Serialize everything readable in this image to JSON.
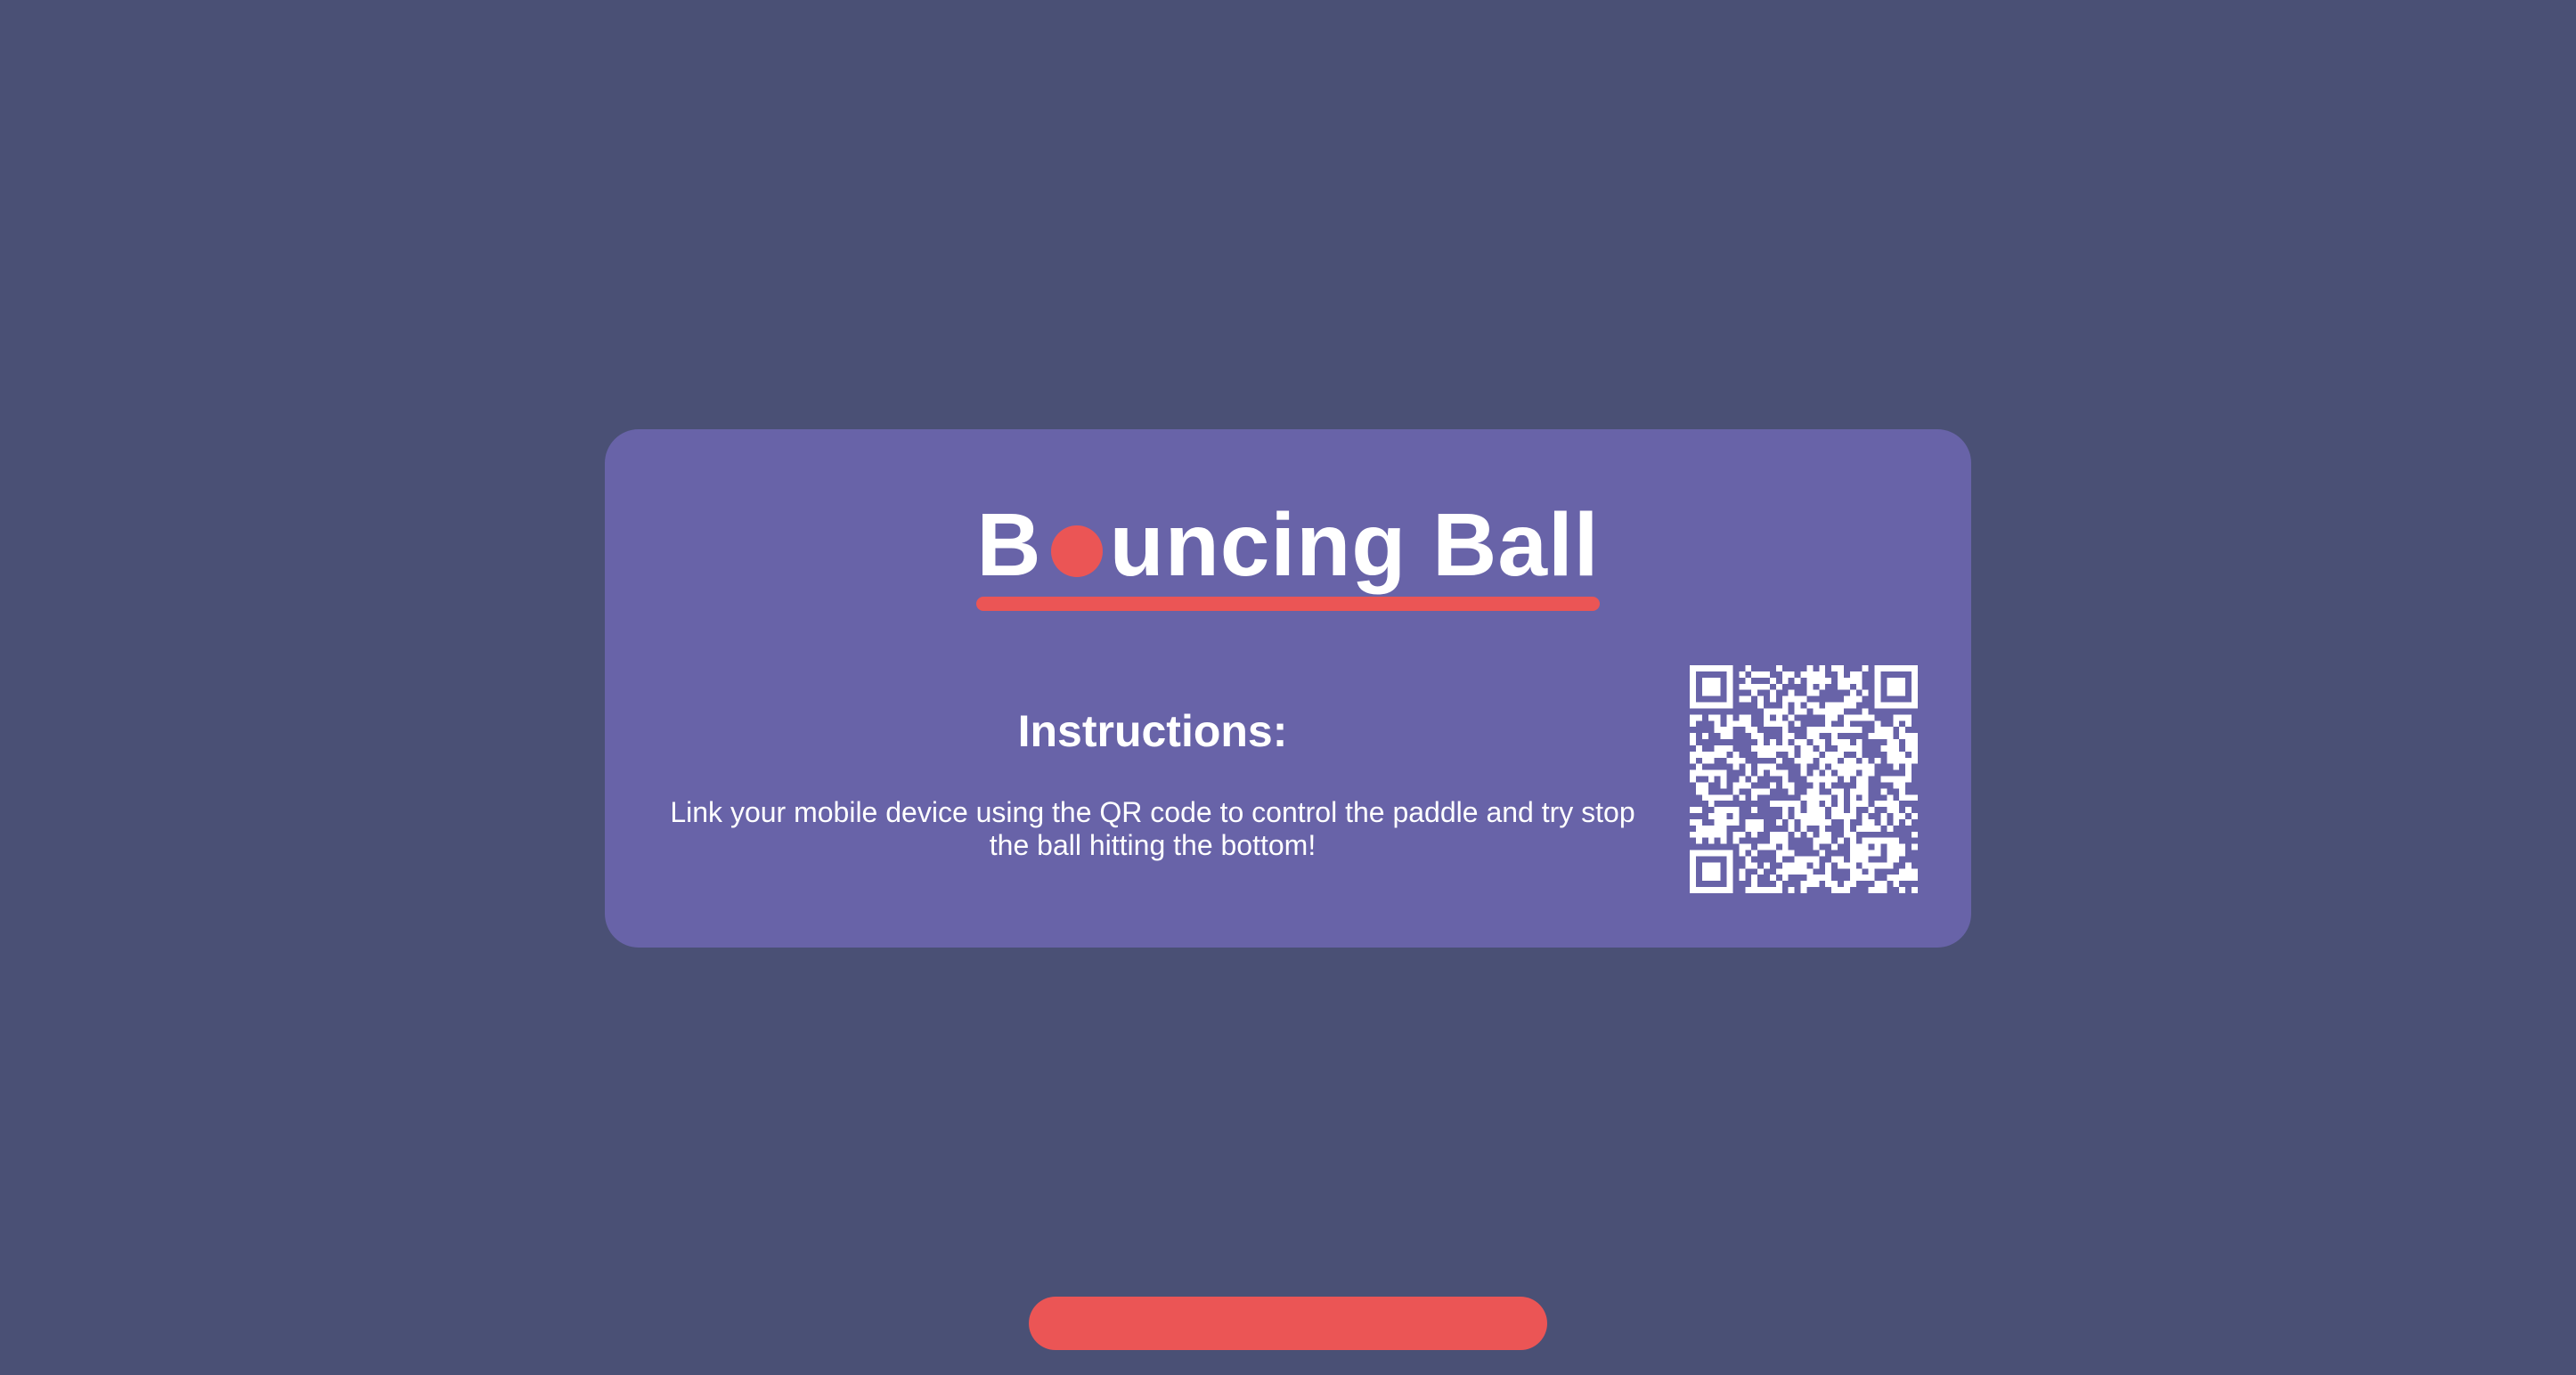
{
  "title": {
    "before_ball": "B",
    "after_ball": "uncing Ball",
    "full_text": "Bouncing Ball"
  },
  "instructions": {
    "heading": "Instructions:",
    "body": "Link your mobile device using the QR code to control the paddle and try stop the ball hitting the bottom!"
  },
  "qr_code": {
    "icon": "qr-code-icon"
  },
  "colors": {
    "background": "#4a5075",
    "card": "#6863a8",
    "accent": "#eb5555",
    "text": "#ffffff"
  }
}
